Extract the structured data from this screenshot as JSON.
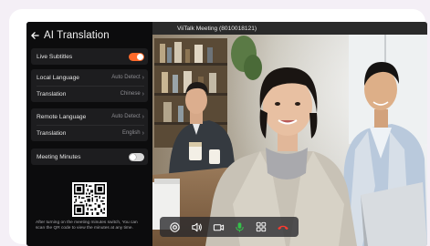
{
  "sidebar": {
    "title": "AI Translation",
    "live_subtitles": {
      "label": "Live Subtitles",
      "enabled": true
    },
    "local": {
      "language_label": "Local Language",
      "language_value": "Auto Detect",
      "translation_label": "Translation",
      "translation_value": "Chinese"
    },
    "remote": {
      "language_label": "Remote Language",
      "language_value": "Auto Detect",
      "translation_label": "Translation",
      "translation_value": "English"
    },
    "meeting_minutes": {
      "label": "Meeting Minutes",
      "enabled": false
    },
    "qr_note": "After turning on the meeting minutes switch, You can scan the QR code to view the minutes at any time."
  },
  "meeting": {
    "title": "ViiTalk Meeting (8010018121)"
  },
  "toolbar": {
    "buttons": [
      "settings-icon",
      "speaker-icon",
      "camera-icon",
      "microphone-icon",
      "grid-icon",
      "hang-up-icon"
    ],
    "accent_color": "#ff6a2b",
    "mic_color": "#35c24a",
    "hangup_color": "#ff3b30"
  }
}
